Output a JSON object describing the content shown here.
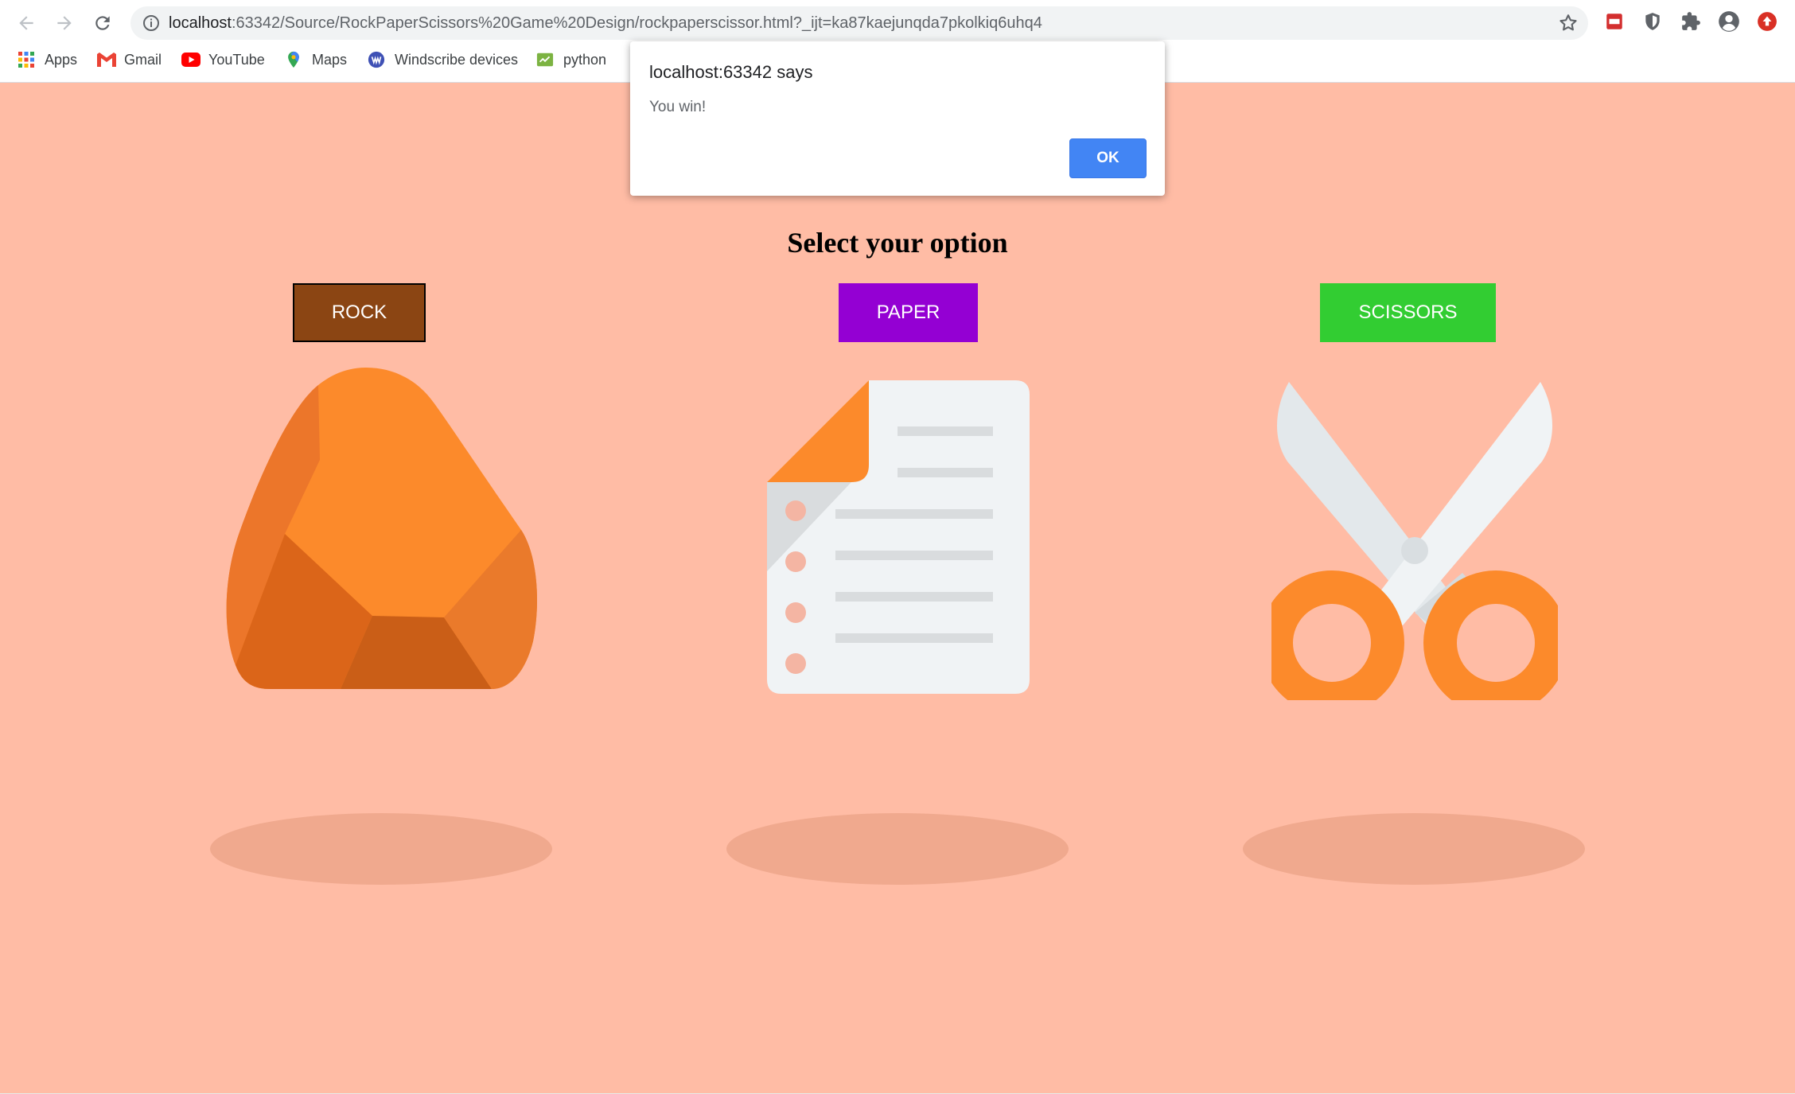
{
  "browser": {
    "url_host": "localhost",
    "url_path": ":63342/Source/RockPaperScissors%20Game%20Design/rockpaperscissor.html?_ijt=ka87kaejunqda7pkolkiq6uhq4",
    "bookmarks": [
      {
        "label": "Apps",
        "icon": "apps-grid-icon"
      },
      {
        "label": "Gmail",
        "icon": "gmail-icon"
      },
      {
        "label": "YouTube",
        "icon": "youtube-icon"
      },
      {
        "label": "Maps",
        "icon": "maps-pin-icon"
      },
      {
        "label": "Windscribe devices",
        "icon": "windscribe-icon"
      },
      {
        "label": "python",
        "icon": "python-icon"
      }
    ]
  },
  "game": {
    "heading": "Select your option",
    "options": [
      {
        "label": "ROCK",
        "color": "#8b4513",
        "icon": "rock-icon"
      },
      {
        "label": "PAPER",
        "color": "#9400d3",
        "icon": "paper-document-icon"
      },
      {
        "label": "SCISSORS",
        "color": "#32cd32",
        "icon": "scissors-icon"
      }
    ],
    "background_color": "#ffbca5"
  },
  "alert": {
    "title": "localhost:63342 says",
    "message": "You win!",
    "ok_label": "OK"
  }
}
